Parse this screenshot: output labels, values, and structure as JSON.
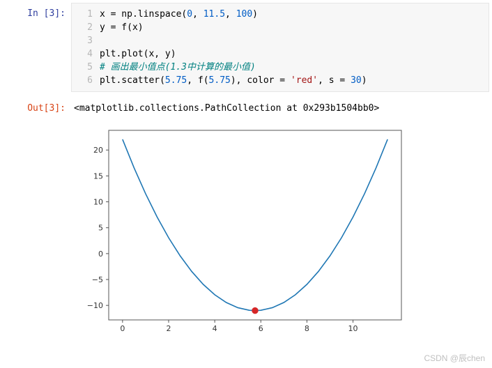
{
  "in_prompt": "In [3]:",
  "out_prompt": "Out[3]:",
  "gutter": [
    "1",
    "2",
    "3",
    "4",
    "5",
    "6"
  ],
  "code": {
    "l1_a": "x = np.linspace(",
    "l1_n1": "0",
    "l1_b": ", ",
    "l1_n2": "11.5",
    "l1_c": ", ",
    "l1_n3": "100",
    "l1_d": ")",
    "l2": "y = f(x)",
    "l3": "",
    "l4": "plt.plot(x, y)",
    "l5": "# 画出最小值点(1.3中计算的最小值)",
    "l6_a": "plt.scatter(",
    "l6_n1": "5.75",
    "l6_b": ", f(",
    "l6_n2": "5.75",
    "l6_c": "), color = ",
    "l6_s1": "'red'",
    "l6_d": ", s = ",
    "l6_n3": "30",
    "l6_e": ")"
  },
  "output_text": "<matplotlib.collections.PathCollection at 0x293b1504bb0>",
  "watermark": "CSDN @辰chen",
  "chart_data": {
    "type": "line",
    "x": [
      0,
      0.5,
      1,
      1.5,
      2,
      2.5,
      3,
      3.5,
      4,
      4.5,
      5,
      5.5,
      5.75,
      6,
      6.5,
      7,
      7.5,
      8,
      8.5,
      9,
      9.5,
      10,
      10.5,
      11,
      11.5
    ],
    "y": [
      22.06,
      16.56,
      11.56,
      7.06,
      3.06,
      -0.44,
      -3.44,
      -5.94,
      -7.94,
      -9.44,
      -10.44,
      -10.94,
      -11.0,
      -10.94,
      -10.44,
      -9.44,
      -7.94,
      -5.94,
      -3.44,
      -0.44,
      3.06,
      7.06,
      11.56,
      16.56,
      22.06
    ],
    "scatter": {
      "x": 5.75,
      "y": -11.0
    },
    "x_ticks": [
      0,
      2,
      4,
      6,
      8,
      10
    ],
    "y_ticks": [
      -10,
      -5,
      0,
      5,
      10,
      15,
      20
    ],
    "xlim": [
      -0.6,
      12.1
    ],
    "ylim": [
      -12.8,
      23.8
    ],
    "minus": "−"
  }
}
